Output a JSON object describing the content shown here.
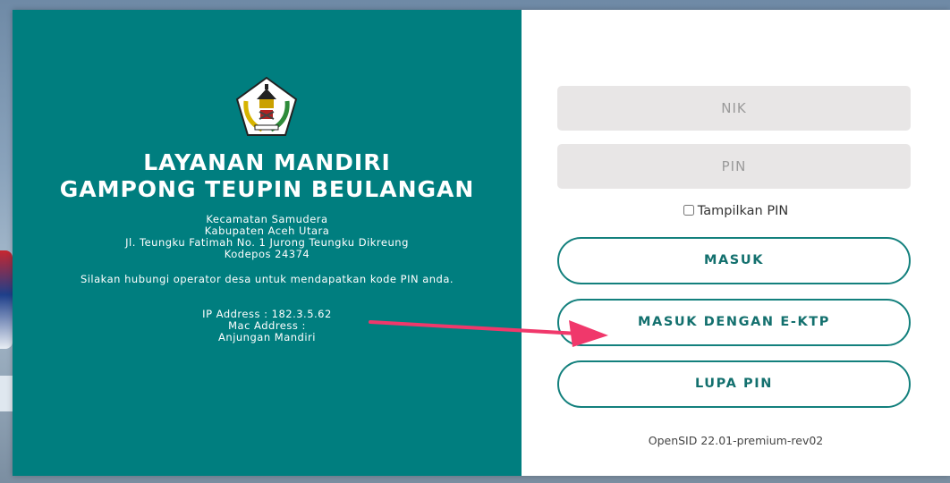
{
  "left": {
    "title_line1": "LAYANAN MANDIRI",
    "title_line2": "GAMPONG TEUPIN BEULANGAN",
    "address": [
      "Kecamatan Samudera",
      "Kabupaten Aceh Utara",
      "Jl. Teungku Fatimah No. 1 Jurong Teungku Dikreung",
      "Kodepos 24374"
    ],
    "note": "Silakan hubungi operator desa untuk mendapatkan kode PIN anda.",
    "ip_address": "IP Address : 182.3.5.62",
    "mac_address": "Mac Address :",
    "device": "Anjungan Mandiri"
  },
  "form": {
    "nik_placeholder": "NIK",
    "pin_placeholder": "PIN",
    "show_pin_label": "Tampilkan PIN",
    "masuk_label": "MASUK",
    "ektp_label": "MASUK DENGAN E-KTP",
    "lupa_label": "LUPA PIN",
    "version": "OpenSID 22.01-premium-rev02"
  },
  "colors": {
    "panel": "#007e7f",
    "button_border": "#13807d",
    "arrow": "#f0386b"
  }
}
